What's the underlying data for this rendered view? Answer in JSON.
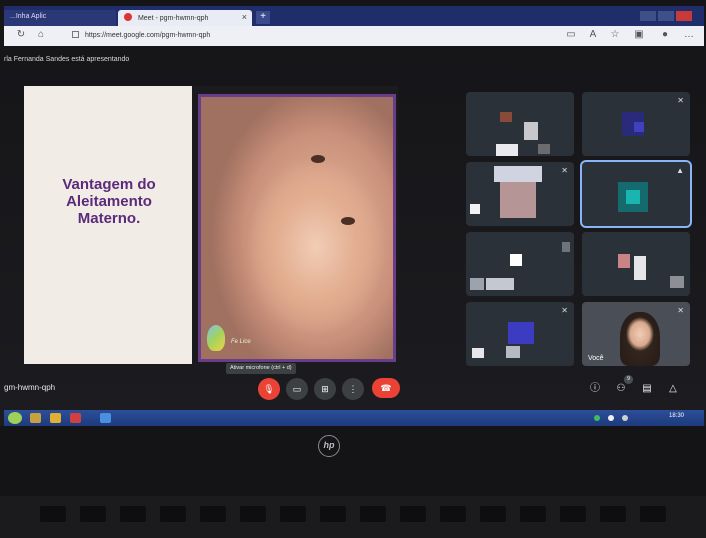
{
  "browser": {
    "tabs": [
      {
        "label": "...Inha Aplic"
      },
      {
        "label": "Meet - pgm-hwmn-qph"
      }
    ],
    "url": "https://meet.google.com/pgm-hwmn-qph"
  },
  "meet": {
    "presenting_text": "rla Fernanda Sandes está apresentando",
    "slide": {
      "title": "Vantagem do\nAleitamento\nMaterno.",
      "logo_text": "Fe Lice"
    },
    "self_label": "Você",
    "tooltip": "Ativar microfone (ctrl + d)",
    "meeting_code": "gm-hwmn-qph",
    "people_count": "9",
    "accent_color": "#8ab4f8",
    "end_call_color": "#ea4335"
  },
  "taskbar": {
    "clock": "18:30"
  },
  "device": {
    "brand": "hp"
  }
}
